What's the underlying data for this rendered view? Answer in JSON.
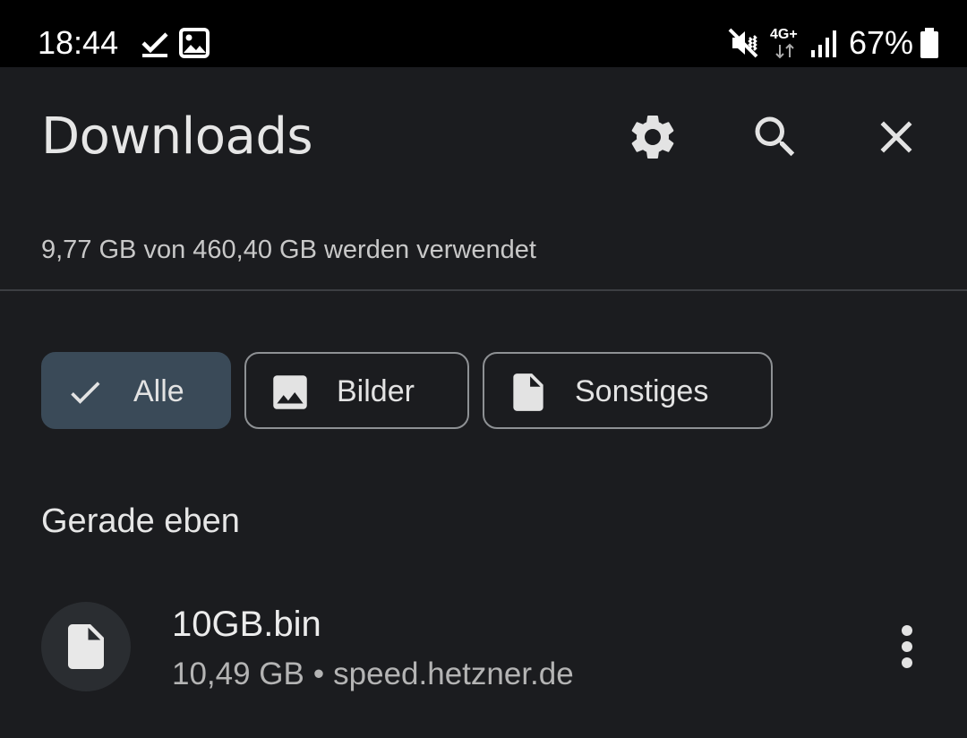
{
  "status_bar": {
    "time": "18:44",
    "network": "4G+",
    "battery_percent": "67%",
    "icons": [
      "download-done-icon",
      "image-icon",
      "vibrate-mute-icon",
      "network-4g-icon",
      "signal-icon",
      "battery-icon"
    ]
  },
  "header": {
    "title": "Downloads",
    "actions": [
      "settings-icon",
      "search-icon",
      "close-icon"
    ]
  },
  "storage": {
    "text": "9,77 GB von 460,40 GB werden verwendet"
  },
  "filters": [
    {
      "label": "Alle",
      "icon": "check-icon",
      "selected": true
    },
    {
      "label": "Bilder",
      "icon": "image-icon",
      "selected": false
    },
    {
      "label": "Sonstiges",
      "icon": "file-icon",
      "selected": false
    }
  ],
  "sections": [
    {
      "title": "Gerade eben",
      "items": [
        {
          "name": "10GB.bin",
          "size": "10,49 GB",
          "separator": "•",
          "source": "speed.hetzner.de",
          "icon": "file-icon"
        }
      ]
    }
  ],
  "colors": {
    "background": "#1b1c1f",
    "status_bar": "#000000",
    "chip_selected": "#3a4a58",
    "chip_border": "#8e9194",
    "divider": "#3c3e42"
  }
}
